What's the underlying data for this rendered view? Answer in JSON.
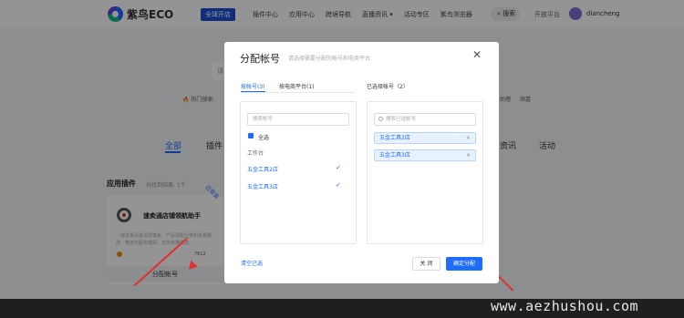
{
  "topbar": {
    "logo_text": "紫鸟ECO",
    "tag": "全球开店",
    "nav": [
      "插件中心",
      "应用中心",
      "跨境导航",
      "直播资讯 ▾",
      "活动专区",
      "紫鸟浏览器"
    ],
    "search_label": "搜索",
    "open_platform": "开放平台",
    "username": "diancheng"
  },
  "background": {
    "search_placeholder": "请",
    "hot_label": "🔥 热门搜索:",
    "side_1": "助理",
    "side_2": "顺嘉",
    "categories": {
      "all": "全部",
      "plugin": "插件",
      "news": "资讯",
      "activity": "活动"
    },
    "section_title": "应用插件",
    "section_count": "共找到结果: 1个",
    "card": {
      "ribbon": "已安装",
      "name": "速卖通店铺领航助手",
      "desc": "一键批量设置运费模板、产品适配分类和批量删改、物流与服务模版、支持批量修改。",
      "count": "7612",
      "button": "分配帐号"
    }
  },
  "modal": {
    "title": "分配帐号",
    "subtitle": "请选择需要分配的帐号和电商平台",
    "close": "✕",
    "tabs": [
      "按帐号(3)",
      "按电商平台(1)"
    ],
    "selected_label": "已选择帐号（2）",
    "left_search_placeholder": "搜索帐号",
    "select_all": "全选",
    "group": "工作台",
    "shops": [
      "五金工具2店",
      "五金工具3店"
    ],
    "tick": "✓",
    "right_search_placeholder": "搜索已选帐号",
    "selected": [
      "五金工具2店",
      "五金工具3店"
    ],
    "remove": "×",
    "clear": "清空已选",
    "cancel": "关 闭",
    "confirm": "确定分配"
  },
  "watermark": "www.aezhushou.com",
  "colors": {
    "accent": "#1d6bff",
    "arrow": "#e03131",
    "overlay": "rgba(0,0,0,0.42)"
  }
}
